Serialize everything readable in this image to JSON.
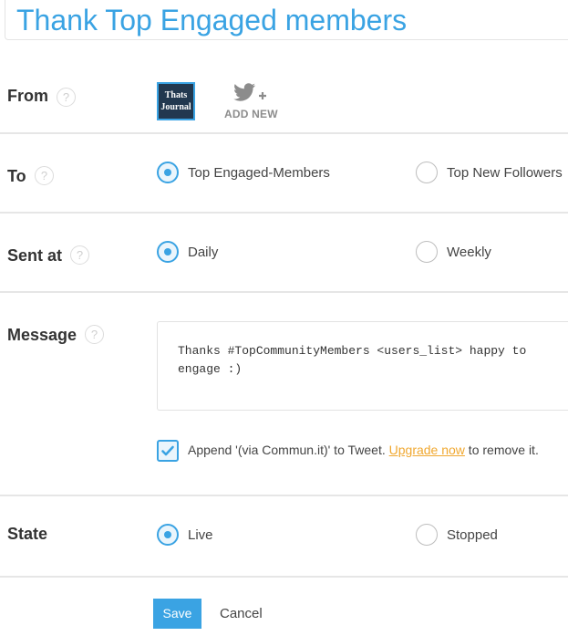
{
  "page": {
    "title": "Thank Top Engaged members"
  },
  "from": {
    "label": "From",
    "help": "?",
    "account_avatar_text": "Thats Journal",
    "add_new_label": "ADD NEW"
  },
  "to": {
    "label": "To",
    "help": "?",
    "options": [
      {
        "label": "Top Engaged-Members",
        "selected": true
      },
      {
        "label": "Top New Followers",
        "selected": false
      }
    ]
  },
  "sent_at": {
    "label": "Sent at",
    "help": "?",
    "options": [
      {
        "label": "Daily",
        "selected": true
      },
      {
        "label": "Weekly",
        "selected": false
      }
    ]
  },
  "message": {
    "label": "Message",
    "help": "?",
    "text": "Thanks #TopCommunityMembers <users_list> happy to engage :)",
    "append_checked": true,
    "append_text_before": "Append '(via Commun.it)' to Tweet. ",
    "upgrade_link": "Upgrade now",
    "append_text_after": " to remove it."
  },
  "state": {
    "label": "State",
    "options": [
      {
        "label": "Live",
        "selected": true
      },
      {
        "label": "Stopped",
        "selected": false
      }
    ]
  },
  "actions": {
    "save_label": "Save",
    "cancel_label": "Cancel"
  },
  "colors": {
    "accent": "#3aa3e3",
    "link": "#f0a830",
    "divider": "#e6e6e6"
  }
}
